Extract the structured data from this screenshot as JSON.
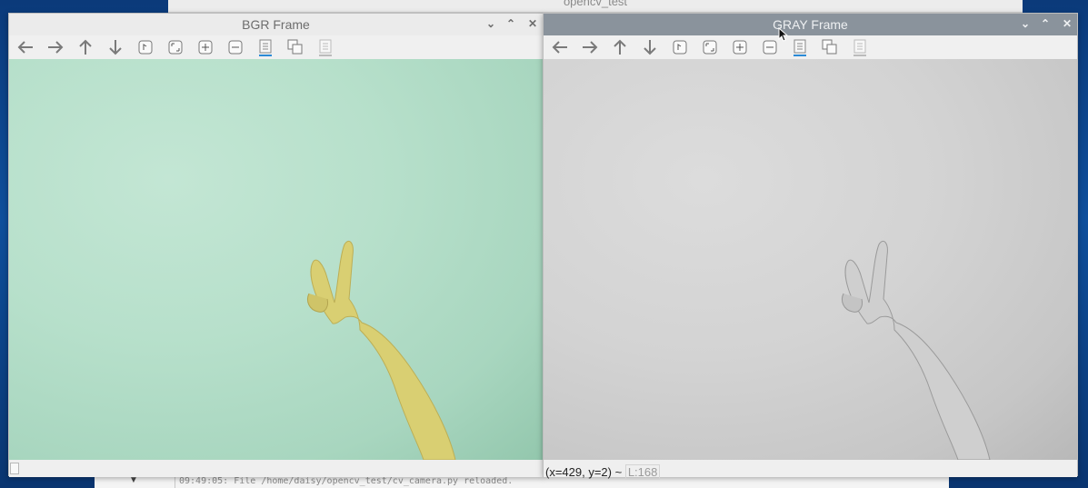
{
  "background_window": {
    "title": "opencv_test"
  },
  "editor": {
    "message": "09:49:05: File /home/daisy/opencv_test/cv_camera.py reloaded."
  },
  "windows": {
    "left": {
      "title": "BGR Frame"
    },
    "right": {
      "title": "GRAY Frame",
      "status": {
        "coords": "(x=429, y=2) ~",
        "luminance": "L:168"
      }
    }
  },
  "controls": {
    "minimize": "⌄",
    "maximize": "⌃",
    "close": "✕"
  },
  "toolbar_icons": [
    "arrow-left-icon",
    "arrow-right-icon",
    "arrow-up-icon",
    "arrow-down-icon",
    "rotate-icon",
    "zoom-fit-icon",
    "zoom-in-icon",
    "zoom-out-icon",
    "save-icon",
    "copy-icon",
    "properties-icon"
  ],
  "colors": {
    "desktop": "#0f4f9c",
    "active_titlebar": "#8a939c",
    "accent_underline": "#2b8ad6",
    "hand_color": "#d9cf72"
  }
}
